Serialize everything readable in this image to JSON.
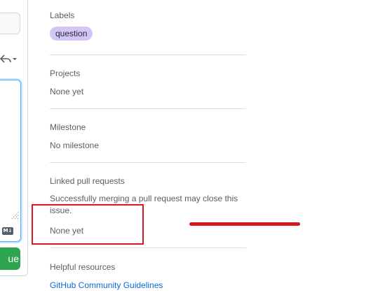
{
  "editor": {
    "submit_label": "ue",
    "markdown_badge": "M↓"
  },
  "sidebar": {
    "labels": {
      "heading": "Labels",
      "items": [
        "question"
      ],
      "color": "#d4c5f9"
    },
    "projects": {
      "heading": "Projects",
      "value": "None yet"
    },
    "milestone": {
      "heading": "Milestone",
      "value": "No milestone"
    },
    "linked_prs": {
      "heading": "Linked pull requests",
      "description": "Successfully merging a pull request may close this issue.",
      "value": "None yet"
    },
    "helpful": {
      "heading": "Helpful resources",
      "link": "GitHub Community Guidelines"
    }
  },
  "colors": {
    "accent_link": "#0969da",
    "submit_green": "#2da44e",
    "annotation_red": "#d7191f"
  }
}
